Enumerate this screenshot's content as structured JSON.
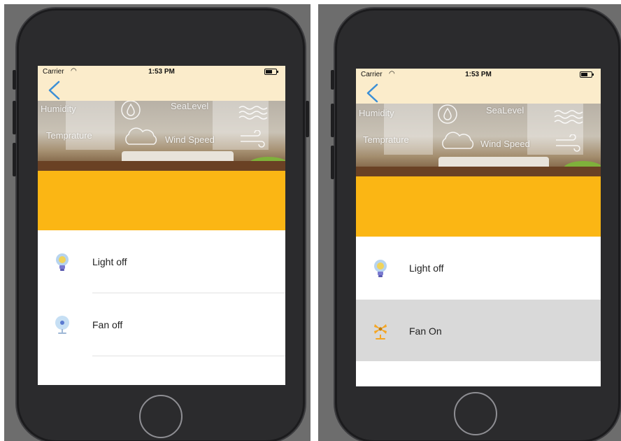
{
  "colors": {
    "status_bar_bg": "#fbeccb",
    "banner": "#fbb614",
    "back_arrow": "#3b8fd6",
    "selected_row_bg": "#d9d9d9",
    "fan_on": "#f5a623"
  },
  "left_screen": {
    "status": {
      "carrier": "Carrier",
      "time": "1:53 PM"
    },
    "hero": {
      "humidity": "Humidity",
      "sea_level": "SeaLevel",
      "temperature": "Temprature",
      "wind_speed": "Wind Speed"
    },
    "devices": [
      {
        "label": "Light off",
        "icon": "lightbulb-icon"
      },
      {
        "label": "Fan off",
        "icon": "fan-icon"
      }
    ]
  },
  "right_screen": {
    "status": {
      "carrier": "Carrier",
      "time": "1:53 PM"
    },
    "hero": {
      "humidity": "Humidity",
      "sea_level": "SeaLevel",
      "temperature": "Temprature",
      "wind_speed": "Wind Speed"
    },
    "devices": [
      {
        "label": "Light off",
        "icon": "lightbulb-icon"
      },
      {
        "label": "Fan On",
        "icon": "fan-on-icon",
        "selected": true
      }
    ]
  }
}
